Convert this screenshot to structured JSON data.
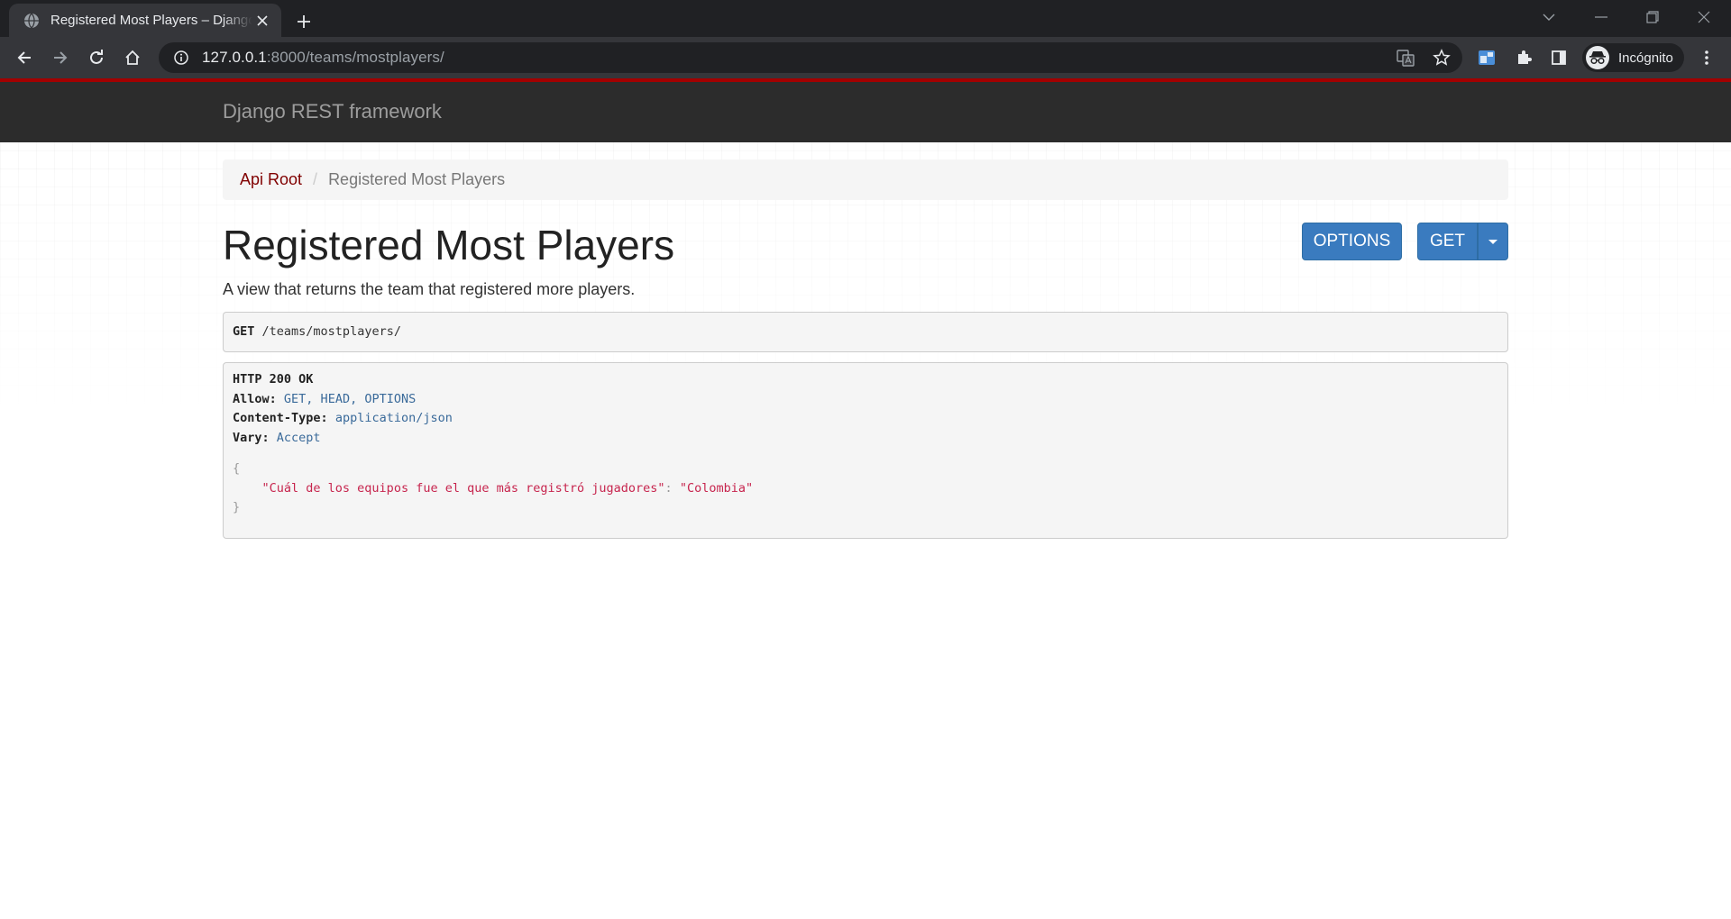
{
  "browser": {
    "tab_title": "Registered Most Players – Django REST framework",
    "url_host": "127.0.0.1",
    "url_rest": ":8000/teams/mostplayers/",
    "profile_label": "Incógnito"
  },
  "drf": {
    "brand": "Django REST framework",
    "breadcrumb": {
      "root": "Api Root",
      "separator": "/",
      "current": "Registered Most Players"
    },
    "title": "Registered Most Players",
    "buttons": {
      "options": "OPTIONS",
      "get": "GET"
    },
    "description": "A view that returns the team that registered more players.",
    "request": {
      "method": "GET",
      "path": "/teams/mostplayers/"
    },
    "response": {
      "status": "HTTP 200 OK",
      "headers": [
        {
          "name": "Allow:",
          "value": "GET, HEAD, OPTIONS"
        },
        {
          "name": "Content-Type:",
          "value": "application/json"
        },
        {
          "name": "Vary:",
          "value": "Accept"
        }
      ],
      "open_brace": "{",
      "body_key": "\"Cuál de los equipos fue el que más registró jugadores\"",
      "body_colon": ": ",
      "body_value": "\"Colombia\"",
      "close_brace": "}"
    }
  },
  "colors": {
    "navbar": "#2c2c2c",
    "navbar_accent": "#a30000",
    "link": "#800000",
    "button": "#3a7bbf",
    "json_string": "#c7254e"
  }
}
